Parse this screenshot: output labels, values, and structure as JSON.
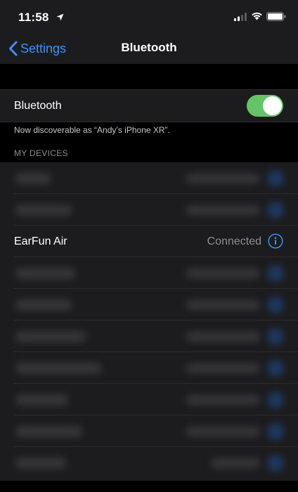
{
  "status_bar": {
    "time": "11:58"
  },
  "nav": {
    "back_label": "Settings",
    "title": "Bluetooth"
  },
  "bluetooth_toggle": {
    "label": "Bluetooth",
    "on": true
  },
  "discoverable_text": "Now discoverable as “Andy’s iPhone XR”.",
  "devices_header": "MY DEVICES",
  "devices": {
    "earfun": {
      "name": "EarFun Air",
      "status": "Connected"
    }
  },
  "colors": {
    "accent": "#3d8ff7",
    "toggle_on": "#65c466",
    "background": "#000000",
    "cell": "#1c1c1e"
  }
}
